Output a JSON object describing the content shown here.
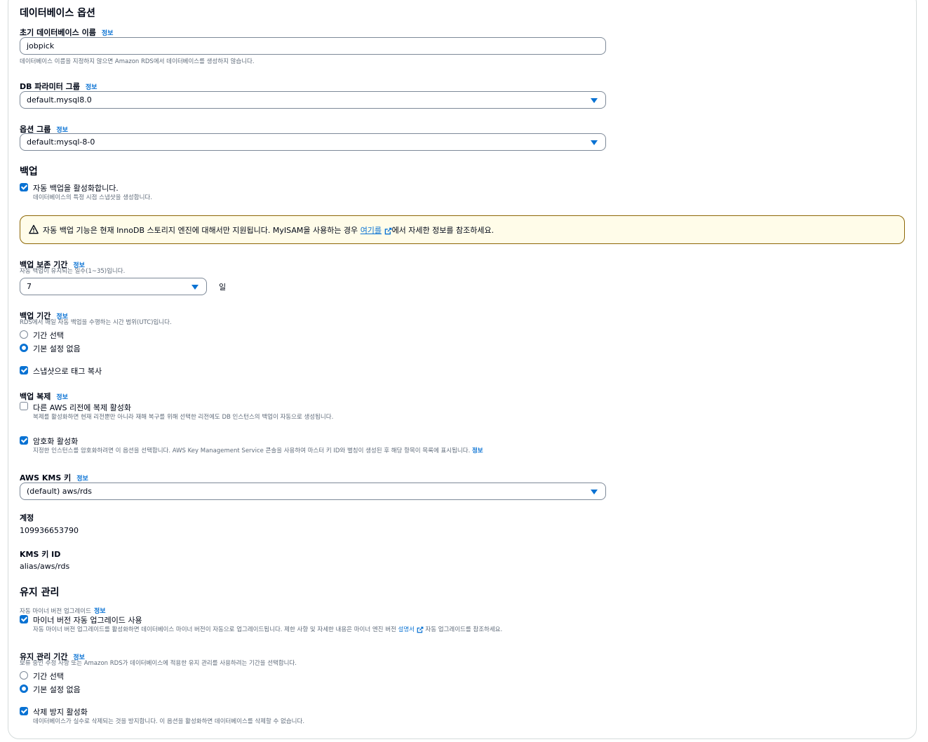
{
  "db_options": {
    "heading": "데이터베이스 옵션",
    "initial_db_name": {
      "label": "초기 데이터베이스 이름",
      "info": "정보",
      "value": "jobpick",
      "description": "데이터베이스 이름을 지정하지 않으면 Amazon RDS에서 데이터베이스를 생성하지 않습니다."
    },
    "param_group": {
      "label": "DB 파라미터 그룹",
      "info": "정보",
      "value": "default.mysql8.0"
    },
    "option_group": {
      "label": "옵션 그룹",
      "info": "정보",
      "value": "default:mysql-8-0"
    }
  },
  "backup": {
    "heading": "백업",
    "auto_backup": {
      "label": "자동 백업을 활성화합니다.",
      "description": "데이터베이스의 특정 시점 스냅샷을 생성합니다.",
      "checked": true
    },
    "alert": {
      "text_before": "자동 백업 기능은 현재 InnoDB 스토리지 엔진에 대해서만 지원됩니다. MyISAM을 사용하는 경우 ",
      "link": "여기를",
      "text_after": "에서 자세한 정보를 참조하세요."
    },
    "retention": {
      "label": "백업 보존 기간",
      "info": "정보",
      "description": "자동 백업이 유지되는 일수(1~35)입니다.",
      "value": "7",
      "unit": "일"
    },
    "window": {
      "label": "백업 기간",
      "info": "정보",
      "description": "RDS에서 매일 자동 백업을 수행하는 시간 범위(UTC)입니다.",
      "options": [
        {
          "label": "기간 선택",
          "selected": false
        },
        {
          "label": "기본 설정 없음",
          "selected": true
        }
      ]
    },
    "copy_tags": {
      "label": "스냅샷으로 태그 복사",
      "checked": true
    },
    "replication": {
      "label": "백업 복제",
      "info": "정보",
      "checkbox_label": "다른 AWS 리전에 복제 활성화",
      "description": "복제를 활성화하면 현재 리전뿐만 아니라 재해 복구를 위해 선택한 리전에도 DB 인스턴스의 백업이 자동으로 생성됩니다.",
      "checked": false
    }
  },
  "encryption": {
    "label": "암호화 활성화",
    "description": "지정한 인스턴스를 암호화하려면 이 옵션을 선택합니다. AWS Key Management Service 콘솔을 사용하여 마스터 키 ID와 별칭이 생성된 후 해당 항목이 목록에 표시됩니다.",
    "info": "정보",
    "checked": true,
    "kms_key": {
      "label": "AWS KMS 키",
      "info": "정보",
      "value": "(default) aws/rds"
    },
    "account": {
      "label": "계정",
      "value": "109936653790"
    },
    "kms_key_id": {
      "label": "KMS 키 ID",
      "value": "alias/aws/rds"
    }
  },
  "maintenance": {
    "heading": "유지 관리",
    "auto_minor": {
      "sub_label": "자동 마이너 버전 업그레이드",
      "info": "정보",
      "label": "마이너 버전 자동 업그레이드 사용",
      "description_before": "자동 마이너 버전 업그레이드를 활성화하면 데이터베이스 마이너 버전이 자동으로 업그레이드됩니다. 제한 사항 및 자세한 내용은 마이너 엔진 버전 ",
      "link": "설명서",
      "description_after": " 자동 업그레이드를 참조하세요.",
      "checked": true
    },
    "window": {
      "label": "유지 관리 기간",
      "info": "정보",
      "description": "보류 중인 수정 사항 또는 Amazon RDS가 데이터베이스에 적용한 유지 관리를 사용하려는 기간을 선택합니다.",
      "options": [
        {
          "label": "기간 선택",
          "selected": false
        },
        {
          "label": "기본 설정 없음",
          "selected": true
        }
      ]
    },
    "deletion_protection": {
      "label": "삭제 방지 활성화",
      "description": "데이터베이스가 실수로 삭제되는 것을 방지합니다. 이 옵션을 활성화하면 데이터베이스를 삭제할 수 없습니다.",
      "checked": true
    }
  },
  "colors": {
    "accent": "#0972d3",
    "warning_border": "#8d6605",
    "warning_bg": "#fffce9"
  },
  "icons": {
    "warning": "warning-icon",
    "external": "external-link-icon",
    "caret": "caret-down-icon"
  }
}
